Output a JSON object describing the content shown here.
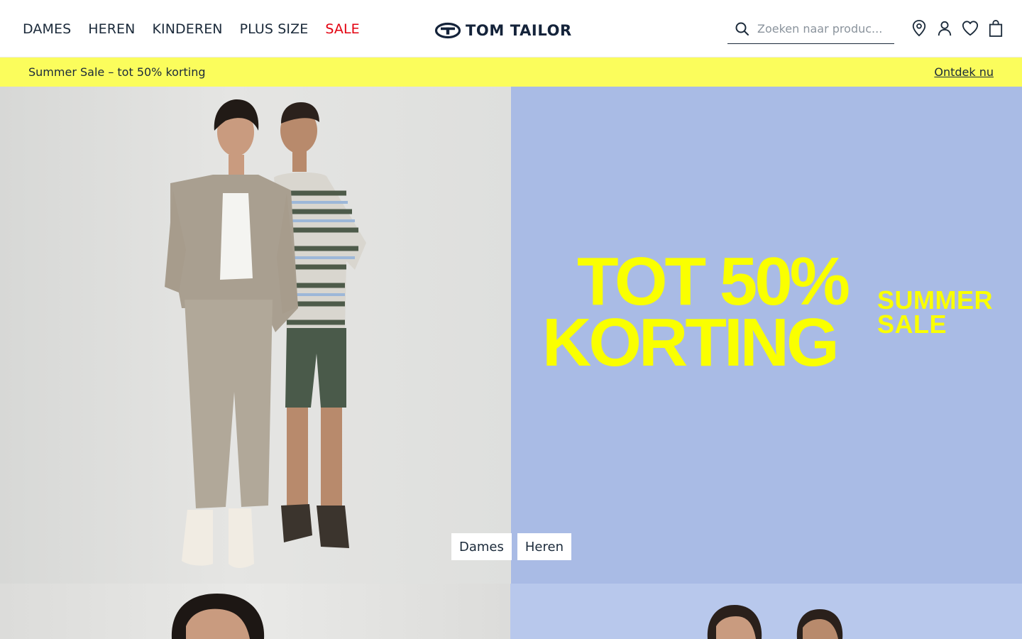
{
  "nav": {
    "items": [
      {
        "label": "DAMES"
      },
      {
        "label": "HEREN"
      },
      {
        "label": "KINDEREN"
      },
      {
        "label": "PLUS SIZE"
      },
      {
        "label": "SALE"
      }
    ]
  },
  "logo": {
    "text": "TOM TAILOR"
  },
  "search": {
    "placeholder": "Zoeken naar produc...",
    "value": ""
  },
  "header_icons": [
    "location-pin-icon",
    "account-icon",
    "wishlist-heart-icon",
    "shopping-bag-icon"
  ],
  "promo": {
    "text": "Summer Sale – tot 50% korting",
    "link": "Ontdek nu"
  },
  "hero": {
    "headline_line1": "TOT 50%",
    "headline_line2": "KORTING",
    "tagline_line1": "SUMMER",
    "tagline_line2": "SALE",
    "buttons": [
      {
        "label": "Dames"
      },
      {
        "label": "Heren"
      }
    ]
  },
  "colors": {
    "promo_bar": "#fbfd5c",
    "hero_right_bg": "#a9bbe5",
    "headline": "#faff00",
    "sale_nav": "#e3000f",
    "text": "#1b2a3a"
  }
}
